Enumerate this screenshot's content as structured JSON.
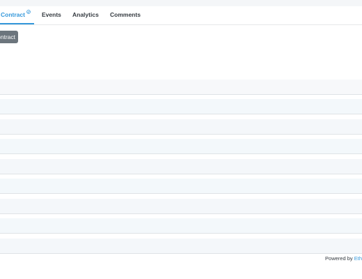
{
  "tabs": [
    {
      "label": "Contract",
      "active": true,
      "verified": true
    },
    {
      "label": "Events",
      "active": false
    },
    {
      "label": "Analytics",
      "active": false
    },
    {
      "label": "Comments",
      "active": false
    }
  ],
  "action_button": {
    "label": "ontract"
  },
  "table": {
    "row_count": 9
  },
  "footer": {
    "powered_by": "Powered by",
    "brand": "Eth"
  },
  "colors": {
    "accent": "#3498db",
    "button": "#6c757d"
  }
}
